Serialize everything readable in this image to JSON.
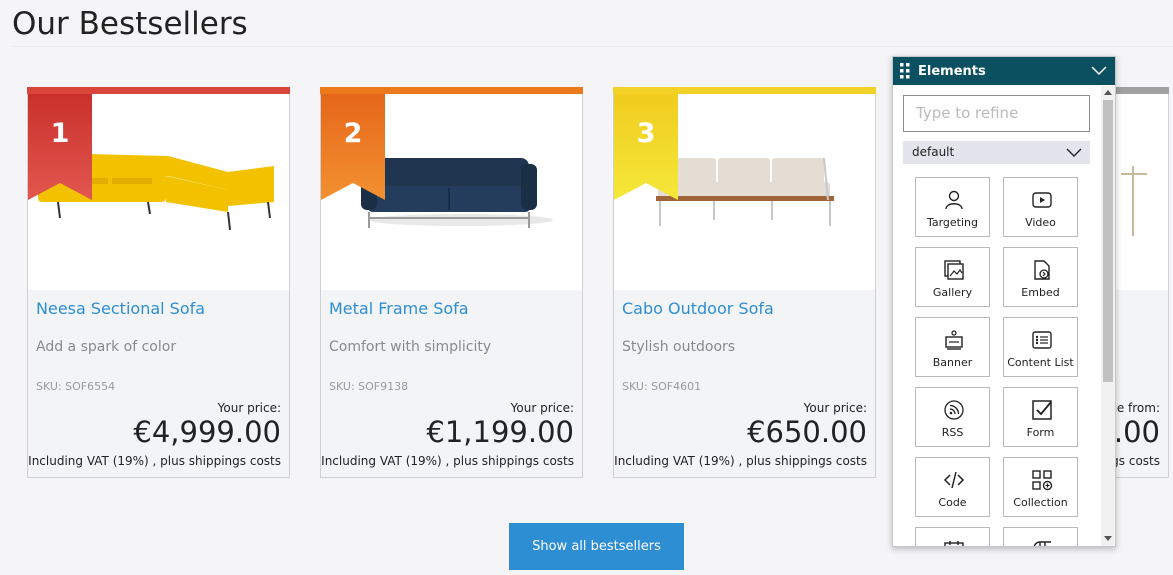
{
  "page": {
    "title": "Our Bestsellers"
  },
  "products": [
    {
      "rank": "1",
      "name": "Neesa Sectional Sofa",
      "description": "Add a spark of color",
      "sku": "SKU: SOF6554",
      "price_label": "Your price:",
      "price": "€4,999.00",
      "vat": "Including VAT (19%) , plus shippings costs",
      "accent": "#d9453a"
    },
    {
      "rank": "2",
      "name": "Metal Frame Sofa",
      "description": "Comfort with simplicity",
      "sku": "SKU: SOF9138",
      "price_label": "Your price:",
      "price": "€1,199.00",
      "vat": "Including VAT (19%) , plus shippings costs",
      "accent": "#ec7a1c"
    },
    {
      "rank": "3",
      "name": "Cabo Outdoor Sofa",
      "description": "Stylish outdoors",
      "sku": "SKU: SOF4601",
      "price_label": "Your price:",
      "price": "€650.00",
      "vat": "Including VAT (19%) , plus shippings costs",
      "accent": "#f2d227"
    },
    {
      "rank": "",
      "name": "",
      "description": "",
      "sku": "",
      "price_label": "ce from:",
      "price": ".00",
      "vat": "gs costs",
      "accent": "#a0a0a0"
    }
  ],
  "show_all_label": "Show all bestsellers",
  "elements_panel": {
    "title": "Elements",
    "refine_placeholder": "Type to refine",
    "filter_value": "default",
    "tiles": [
      {
        "label": "Targeting",
        "icon": "person-icon"
      },
      {
        "label": "Video",
        "icon": "video-icon"
      },
      {
        "label": "Gallery",
        "icon": "gallery-icon"
      },
      {
        "label": "Embed",
        "icon": "embed-icon"
      },
      {
        "label": "Banner",
        "icon": "banner-icon"
      },
      {
        "label": "Content List",
        "icon": "content-list-icon"
      },
      {
        "label": "RSS",
        "icon": "rss-icon"
      },
      {
        "label": "Form",
        "icon": "form-icon"
      },
      {
        "label": "Code",
        "icon": "code-icon"
      },
      {
        "label": "Collection",
        "icon": "collection-icon"
      },
      {
        "label": "",
        "icon": "calendar-icon"
      },
      {
        "label": "",
        "icon": "table-icon"
      }
    ]
  },
  "colors": {
    "link": "#2d8ed3",
    "panel_header": "#0b5060",
    "button": "#2d8ed3"
  }
}
